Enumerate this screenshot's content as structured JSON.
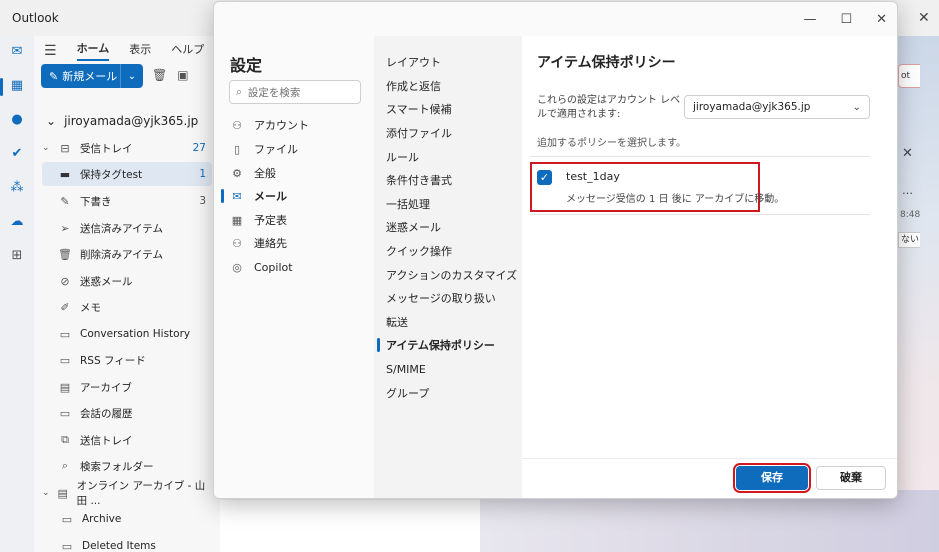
{
  "app": {
    "title": "Outlook",
    "close_glyph": "✕"
  },
  "ribbon": {
    "tabs": [
      {
        "label": "ホーム",
        "active": true
      },
      {
        "label": "表示",
        "active": false
      },
      {
        "label": "ヘルプ",
        "active": false
      }
    ],
    "new_mail_label": "新規メール"
  },
  "account": {
    "email": "jiroyamada@yjk365.jp"
  },
  "folders": [
    {
      "label": "受信トレイ",
      "count": "27",
      "icon": "inbox-icon"
    },
    {
      "label": "保持タグtest",
      "count": "1",
      "icon": "folder-icon"
    },
    {
      "label": "下書き",
      "count": "3",
      "icon": "draft-icon"
    },
    {
      "label": "送信済みアイテム",
      "count": "",
      "icon": "send-icon"
    },
    {
      "label": "削除済みアイテム",
      "count": "",
      "icon": "trash-icon"
    },
    {
      "label": "迷惑メール",
      "count": "",
      "icon": "junk-icon"
    },
    {
      "label": "メモ",
      "count": "",
      "icon": "note-icon"
    },
    {
      "label": "Conversation History",
      "count": "",
      "icon": "folder-icon"
    },
    {
      "label": "RSS フィード",
      "count": "",
      "icon": "folder-icon"
    },
    {
      "label": "アーカイブ",
      "count": "",
      "icon": "archive-icon"
    },
    {
      "label": "会話の履歴",
      "count": "",
      "icon": "folder-icon"
    },
    {
      "label": "送信トレイ",
      "count": "",
      "icon": "outbox-icon"
    },
    {
      "label": "検索フォルダー",
      "count": "",
      "icon": "search-folder-icon"
    },
    {
      "label": "オンライン アーカイブ - 山田 ...",
      "count": "",
      "icon": "archive-icon"
    },
    {
      "label": "Archive",
      "count": "",
      "icon": "folder-icon"
    },
    {
      "label": "Deleted Items",
      "count": "",
      "icon": "folder-icon"
    }
  ],
  "settings": {
    "title": "設定",
    "search_placeholder": "設定を検索",
    "categories": [
      {
        "label": "アカウント",
        "icon": "person-icon"
      },
      {
        "label": "ファイル",
        "icon": "file-icon"
      },
      {
        "label": "全般",
        "icon": "gear-icon"
      },
      {
        "label": "メール",
        "icon": "mail-icon",
        "active": true
      },
      {
        "label": "予定表",
        "icon": "calendar-icon"
      },
      {
        "label": "連絡先",
        "icon": "people-icon"
      },
      {
        "label": "Copilot",
        "icon": "copilot-icon"
      }
    ],
    "mail_sections": [
      "レイアウト",
      "作成と返信",
      "スマート候補",
      "添付ファイル",
      "ルール",
      "条件付き書式",
      "一括処理",
      "迷惑メール",
      "クイック操作",
      "アクションのカスタマイズ",
      "メッセージの取り扱い",
      "転送",
      "アイテム保持ポリシー",
      "S/MIME",
      "グループ"
    ],
    "active_section_index": 12
  },
  "panel": {
    "title": "アイテム保持ポリシー",
    "account_label": "これらの設定はアカウント レベルで適用されます:",
    "account_value": "jiroyamada@yjk365.jp",
    "hint": "追加するポリシーを選択します。",
    "policy": {
      "name": "test_1day",
      "description": "メッセージ受信の 1 日 後に アーカイブに移動。",
      "checked": true
    },
    "save_label": "保存",
    "discard_label": "破棄"
  },
  "peek": {
    "button_text": "ot",
    "tag_text": "ない",
    "time_text": "8:48"
  },
  "colors": {
    "accent": "#0f6cbd",
    "highlight": "#d0191f"
  }
}
